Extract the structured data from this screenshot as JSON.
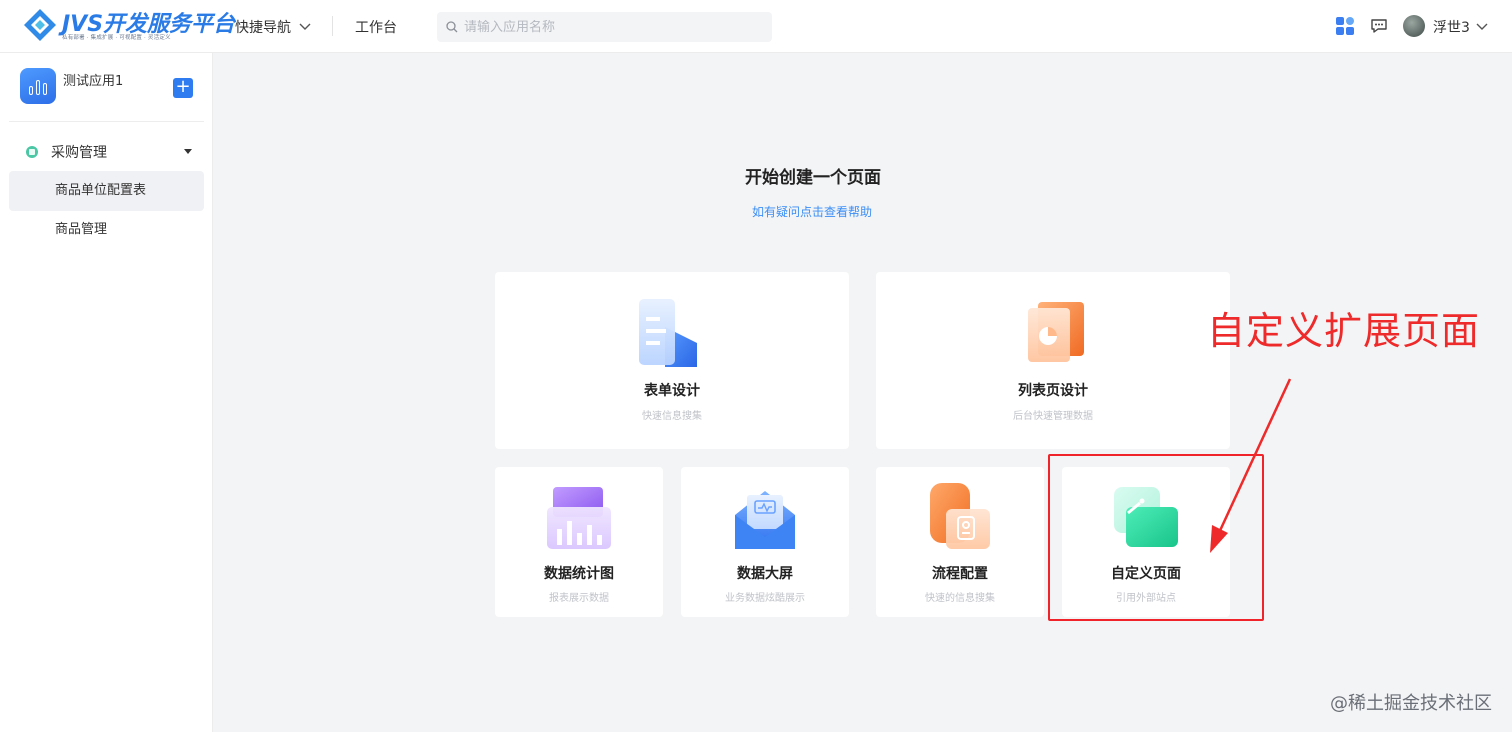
{
  "header": {
    "logo_title": "JVS开发服务平台",
    "logo_subtitle": "私有部署 · 集成扩展 · 可视配置 · 灵活定义",
    "nav_quick": "快捷导航",
    "nav_workbench": "工作台",
    "search_placeholder": "请输入应用名称",
    "user_name": "浮世3"
  },
  "sidebar": {
    "app_name": "测试应用1",
    "group_label": "采购管理",
    "items": [
      {
        "label": "商品单位配置表",
        "active": true
      },
      {
        "label": "商品管理",
        "active": false
      }
    ]
  },
  "main": {
    "title": "开始创建一个页面",
    "help_link": "如有疑问点击查看帮助",
    "cards": [
      {
        "title": "表单设计",
        "subtitle": "快速信息搜集"
      },
      {
        "title": "列表页设计",
        "subtitle": "后台快速管理数据"
      },
      {
        "title": "数据统计图",
        "subtitle": "报表展示数据"
      },
      {
        "title": "数据大屏",
        "subtitle": "业务数据炫酷展示"
      },
      {
        "title": "流程配置",
        "subtitle": "快速的信息搜集"
      },
      {
        "title": "自定义页面",
        "subtitle": "引用外部站点"
      }
    ]
  },
  "annotation": {
    "text": "自定义扩展页面",
    "color": "#ee2a2a"
  },
  "watermark": "@稀土掘金技术社区",
  "colors": {
    "brand": "#2f7bf0",
    "link": "#3b8ef5",
    "annotation": "#f0222a"
  }
}
